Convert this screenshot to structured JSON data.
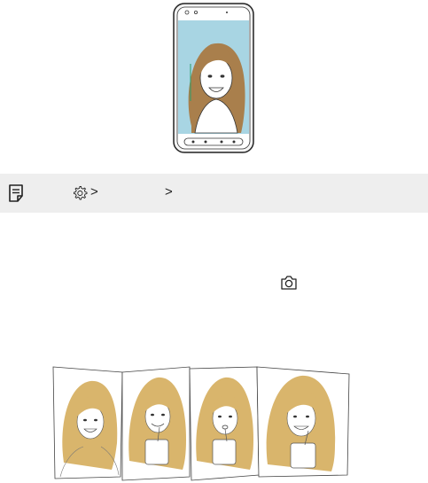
{
  "note": {
    "breadcrumb_sep_1": ">",
    "breadcrumb_sep_2": ">",
    "icons": [
      "note-icon",
      "gear-icon"
    ]
  },
  "body": {
    "icons": [
      "camera-icon"
    ]
  },
  "illustrations": {
    "phone": "phone-selfie-illustration",
    "sequence": "gesture-interval-shot-sequence",
    "frame_count": 4
  },
  "colors": {
    "note_bar": "#eeeeee",
    "phone_screen_bg": "#a8d5e3",
    "hair": "#d9b56c",
    "phone_outline": "#222222"
  }
}
